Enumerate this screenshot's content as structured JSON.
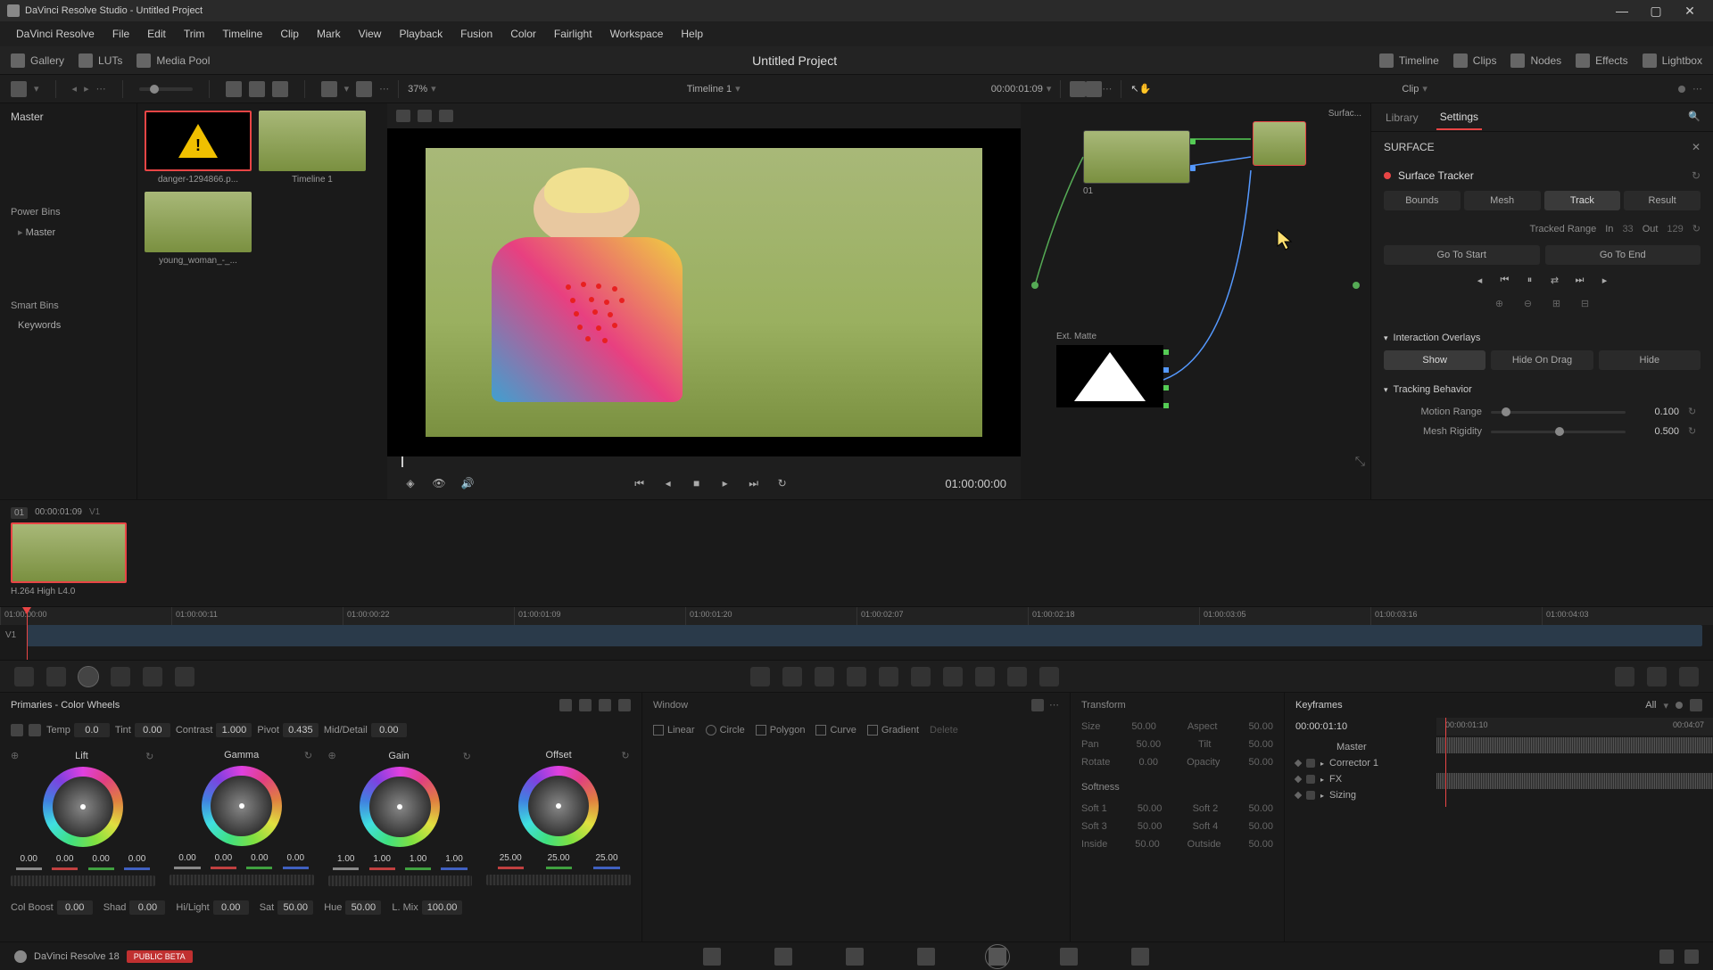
{
  "app": {
    "title": "DaVinci Resolve Studio - Untitled Project",
    "project_title": "Untitled Project"
  },
  "menu": [
    "DaVinci Resolve",
    "File",
    "Edit",
    "Trim",
    "Timeline",
    "Clip",
    "Mark",
    "View",
    "Playback",
    "Fusion",
    "Color",
    "Fairlight",
    "Workspace",
    "Help"
  ],
  "toolbar": {
    "gallery": "Gallery",
    "luts": "LUTs",
    "media_pool": "Media Pool",
    "timeline": "Timeline",
    "clips": "Clips",
    "nodes": "Nodes",
    "effects": "Effects",
    "lightbox": "Lightbox"
  },
  "secbar": {
    "zoom": "37%",
    "timeline_name": "Timeline 1",
    "timecode": "00:00:01:09",
    "clip": "Clip"
  },
  "left_panel": {
    "master": "Master",
    "power_bins": "Power Bins",
    "master_sub": "Master",
    "smart_bins": "Smart Bins",
    "keywords": "Keywords"
  },
  "media": {
    "clip1": "danger-1294866.p...",
    "clip2": "Timeline 1",
    "clip3": "young_woman_-_..."
  },
  "viewer": {
    "timecode": "01:00:00:00"
  },
  "nodes": {
    "node1_label": "01",
    "ext_matte": "Ext. Matte",
    "surface_label": "Surfac..."
  },
  "inspector": {
    "tabs": {
      "library": "Library",
      "settings": "Settings"
    },
    "header": "SURFACE",
    "title": "Surface Tracker",
    "pills": {
      "bounds": "Bounds",
      "mesh": "Mesh",
      "track": "Track",
      "result": "Result"
    },
    "tracked_range": "Tracked Range",
    "in_label": "In",
    "in_val": "33",
    "out_label": "Out",
    "out_val": "129",
    "goto_start": "Go To Start",
    "goto_end": "Go To End",
    "interaction": "Interaction Overlays",
    "show": "Show",
    "hide_drag": "Hide On Drag",
    "hide": "Hide",
    "tracking_behavior": "Tracking Behavior",
    "motion_range": "Motion Range",
    "motion_val": "0.100",
    "mesh_rigidity": "Mesh Rigidity",
    "mesh_val": "0.500"
  },
  "strip": {
    "clip_num": "01",
    "timecode": "00:00:01:09",
    "track": "V1",
    "codec": "H.264 High L4.0"
  },
  "timeline_ruler": [
    "01:00:00:00",
    "01:00:00:11",
    "01:00:00:22",
    "01:00:01:09",
    "01:00:01:20",
    "01:00:02:07",
    "01:00:02:18",
    "01:00:03:05",
    "01:00:03:16",
    "01:00:04:03"
  ],
  "timeline": {
    "track": "V1"
  },
  "wheels": {
    "title": "Primaries - Color Wheels",
    "adj1": {
      "temp": "Temp",
      "temp_v": "0.0",
      "tint": "Tint",
      "tint_v": "0.00",
      "contrast": "Contrast",
      "contrast_v": "1.000",
      "pivot": "Pivot",
      "pivot_v": "0.435",
      "md": "Mid/Detail",
      "md_v": "0.00"
    },
    "lift": "Lift",
    "gamma": "Gamma",
    "gain": "Gain",
    "offset": "Offset",
    "lift_vals": [
      "0.00",
      "0.00",
      "0.00",
      "0.00"
    ],
    "gamma_vals": [
      "0.00",
      "0.00",
      "0.00",
      "0.00"
    ],
    "gain_vals": [
      "1.00",
      "1.00",
      "1.00",
      "1.00"
    ],
    "offset_vals": [
      "25.00",
      "25.00",
      "25.00"
    ],
    "adj2": {
      "cb": "Col Boost",
      "cb_v": "0.00",
      "shad": "Shad",
      "shad_v": "0.00",
      "hl": "Hi/Light",
      "hl_v": "0.00",
      "sat": "Sat",
      "sat_v": "50.00",
      "hue": "Hue",
      "hue_v": "50.00",
      "lm": "L. Mix",
      "lm_v": "100.00"
    }
  },
  "window": {
    "title": "Window",
    "shapes": {
      "linear": "Linear",
      "circle": "Circle",
      "polygon": "Polygon",
      "curve": "Curve",
      "gradient": "Gradient",
      "delete": "Delete"
    }
  },
  "transform": {
    "title": "Transform",
    "softness": "Softness",
    "rows": [
      {
        "l": "Size",
        "lv": "50.00",
        "r": "Aspect",
        "rv": "50.00"
      },
      {
        "l": "Pan",
        "lv": "50.00",
        "r": "Tilt",
        "rv": "50.00"
      },
      {
        "l": "Rotate",
        "lv": "0.00",
        "r": "Opacity",
        "rv": "50.00"
      }
    ],
    "soft_rows": [
      {
        "l": "Soft 1",
        "lv": "50.00",
        "r": "Soft 2",
        "rv": "50.00"
      },
      {
        "l": "Soft 3",
        "lv": "50.00",
        "r": "Soft 4",
        "rv": "50.00"
      },
      {
        "l": "Inside",
        "lv": "50.00",
        "r": "Outside",
        "rv": "50.00"
      }
    ]
  },
  "keyframes": {
    "title": "Keyframes",
    "all": "All",
    "timecode": "00:00:01:10",
    "ruler": [
      "00:00:01:10",
      "00:04:07"
    ],
    "tree": [
      "Master",
      "Corrector 1",
      "FX",
      "Sizing"
    ]
  },
  "footer": {
    "app": "DaVinci Resolve 18",
    "badge": "PUBLIC BETA"
  }
}
